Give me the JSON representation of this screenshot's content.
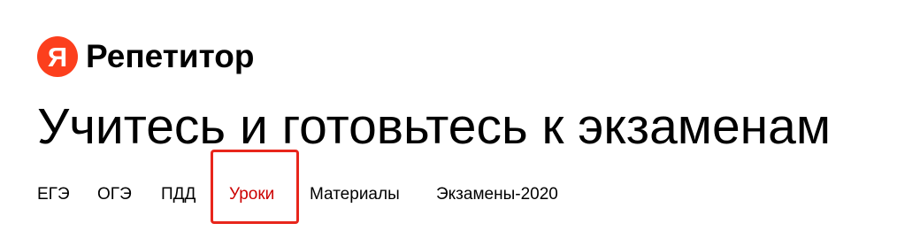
{
  "header": {
    "logo_letter": "Я",
    "logo_text": "Репетитор"
  },
  "main": {
    "title": "Учитесь и готовьтесь к экзаменам"
  },
  "nav": {
    "items": [
      {
        "label": "ЕГЭ"
      },
      {
        "label": "ОГЭ"
      },
      {
        "label": "ПДД"
      },
      {
        "label": "Уроки"
      },
      {
        "label": "Материалы"
      },
      {
        "label": "Экзамены-2020"
      }
    ],
    "active_index": 3
  },
  "colors": {
    "brand": "#fc3f1d",
    "active_link": "#cc0000",
    "highlight_border": "#e8261c"
  }
}
